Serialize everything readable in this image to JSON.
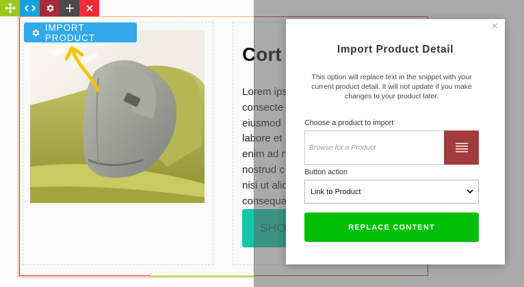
{
  "colors": {
    "move": "#9ac71c",
    "code": "#16a3dd",
    "settings": "#a8293a",
    "add": "#4a4a4a",
    "delete": "#ee2b36",
    "import_button": "#30a8ea",
    "browse_button": "#a33b3d",
    "replace_button": "#00bf06",
    "shop_button": "#11c8a8"
  },
  "toolbar": {
    "icons": [
      "move-icon",
      "code-icon",
      "gear-icon",
      "plus-icon",
      "close-icon"
    ]
  },
  "snippet": {
    "import_button_label": "IMPORT PRODUCT",
    "headline": "Cort",
    "body_lines": [
      "Lorem ips",
      "consecte",
      "eiusmod",
      "labore et",
      "enim ad r",
      "nostrud c",
      "nisi ut aliq",
      "consequa"
    ],
    "shop_button_label": "SHO"
  },
  "modal": {
    "title": "Import Product Detail",
    "description": "This option will replace text in the snippet with your current product detail. It will not update if you make changes to your product later.",
    "product_label": "Choose a product to import",
    "product_placeholder": "Browse for a Product",
    "action_label": "Button action",
    "action_value": "Link to Product",
    "replace_label": "REPLACE CONTENT",
    "close_glyph": "×"
  }
}
